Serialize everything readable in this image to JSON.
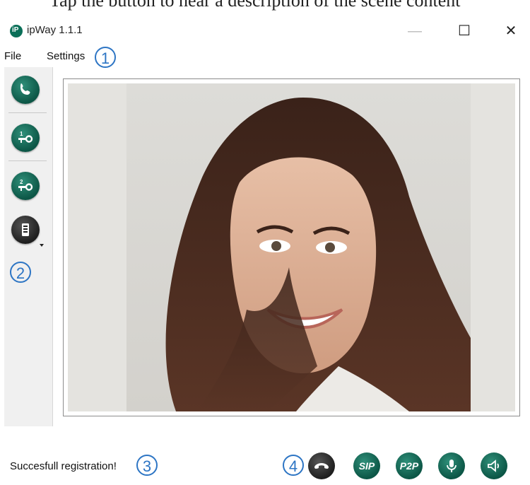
{
  "top_clip": {
    "text": "Tap the button to hear a description of the scene content"
  },
  "window": {
    "title": "ipWay 1.1.1",
    "minimize": "—",
    "maximize": "☐",
    "close": "✕"
  },
  "menu": {
    "items": [
      "File",
      "Settings"
    ],
    "callout": "1"
  },
  "toolbar": {
    "callout": "2",
    "buttons": [
      {
        "name": "call-icon"
      },
      {
        "name": "door-key-1-icon",
        "label": "1"
      },
      {
        "name": "door-key-2-icon",
        "label": "2"
      },
      {
        "name": "intercom-panel-icon"
      }
    ]
  },
  "status": {
    "text": "Succesfull registration!",
    "callout": "3"
  },
  "controls": {
    "callout": "4",
    "buttons": [
      {
        "name": "hangup-icon"
      },
      {
        "label": "SIP"
      },
      {
        "label": "P2P"
      },
      {
        "name": "microphone-icon"
      },
      {
        "name": "speaker-icon"
      }
    ]
  },
  "colors": {
    "accent": "#0c5646",
    "callout": "#2d75c4",
    "hangup": "#1e1e1e"
  }
}
